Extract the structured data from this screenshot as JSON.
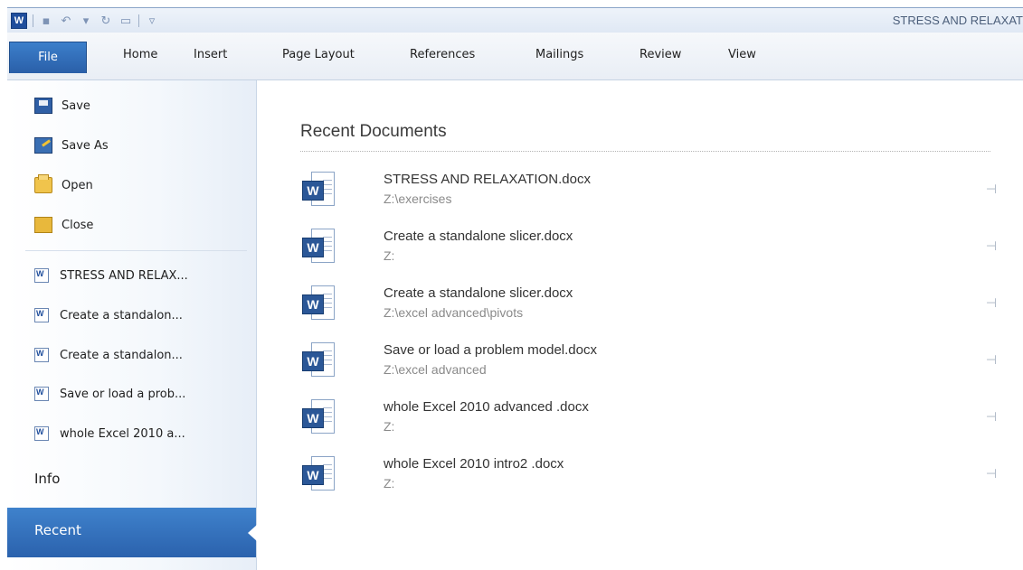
{
  "window": {
    "title": "STRESS AND RELAXAT"
  },
  "quick_access": {
    "app_logo": "W",
    "icons": [
      "save-icon",
      "undo-icon",
      "redo-icon",
      "new-document-icon",
      "customize-qat-icon"
    ]
  },
  "ribbon": {
    "file_tab": "File",
    "tabs": [
      "Home",
      "Insert",
      "Page Layout",
      "References",
      "Mailings",
      "Review",
      "View"
    ]
  },
  "backstage": {
    "commands": [
      {
        "label": "Save",
        "icon": "save-icon"
      },
      {
        "label": "Save As",
        "icon": "save-as-icon"
      },
      {
        "label": "Open",
        "icon": "open-folder-icon"
      },
      {
        "label": "Close",
        "icon": "close-folder-icon"
      }
    ],
    "recent_quick": [
      "STRESS AND RELAX...",
      "Create a standalon...",
      "Create a standalon...",
      "Save or load a prob...",
      "whole Excel 2010 a..."
    ],
    "info_label": "Info",
    "recent_label": "Recent"
  },
  "recent_documents": {
    "heading": "Recent Documents",
    "items": [
      {
        "name": "STRESS AND RELAXATION.docx",
        "path": "Z:\\exercises"
      },
      {
        "name": "Create a standalone slicer.docx",
        "path": "Z:"
      },
      {
        "name": "Create a standalone slicer.docx",
        "path": "Z:\\excel advanced\\pivots"
      },
      {
        "name": "Save or load a problem model.docx",
        "path": "Z:\\excel advanced"
      },
      {
        "name": "whole Excel 2010 advanced .docx",
        "path": "Z:"
      },
      {
        "name": "whole Excel 2010 intro2 .docx",
        "path": "Z:"
      }
    ]
  },
  "colors": {
    "accent": "#2b62ad",
    "file_tab": "#3c7fcb"
  }
}
